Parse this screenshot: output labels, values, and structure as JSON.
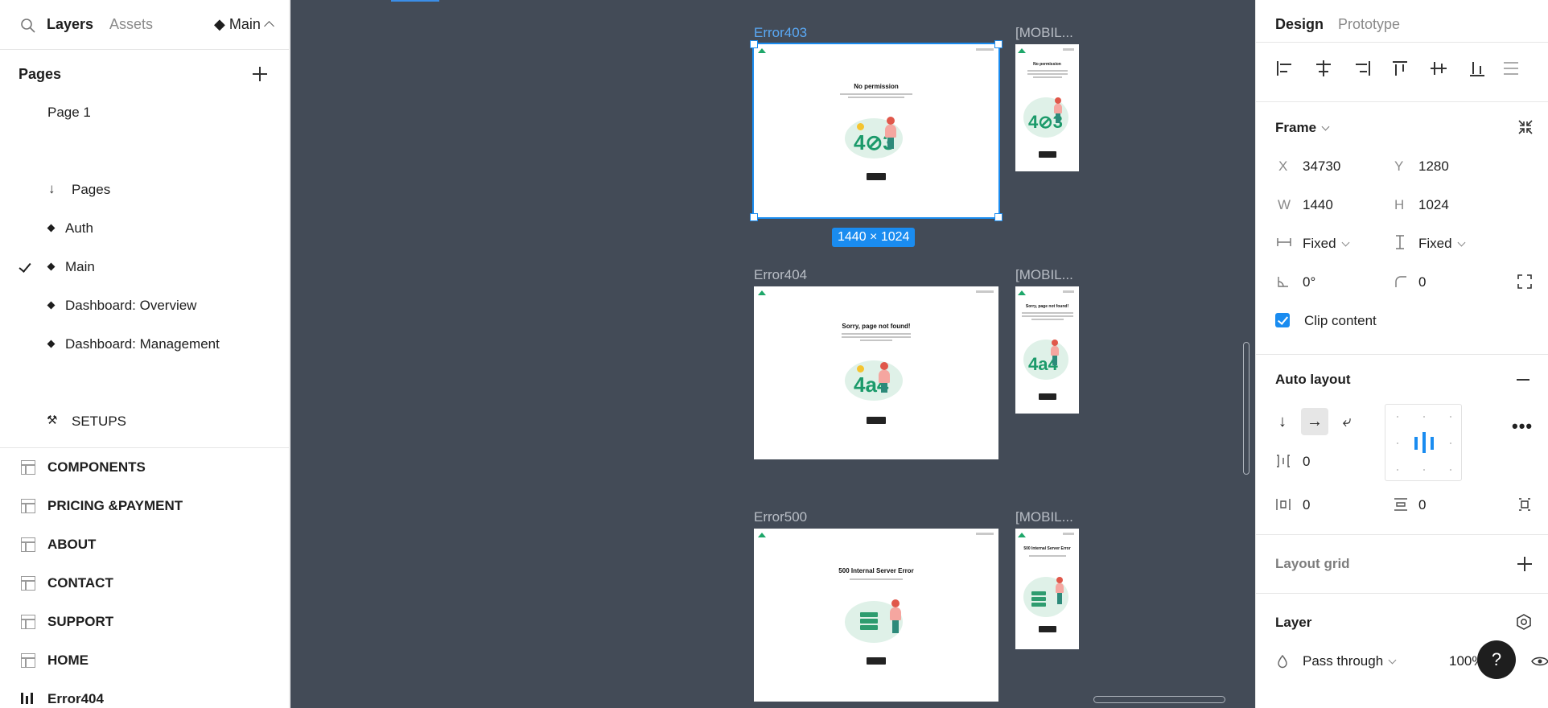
{
  "left_panel": {
    "tabs": {
      "layers": "Layers",
      "assets": "Assets"
    },
    "page_switcher": "◆ Main",
    "pages_heading": "Pages",
    "pages": [
      {
        "label": "Page 1",
        "marker": "none"
      },
      {
        "label": "Pages",
        "marker": "arrow"
      },
      {
        "label": "Auth",
        "marker": "diamond"
      },
      {
        "label": "Main",
        "marker": "diamond",
        "current": true
      },
      {
        "label": "Dashboard: Overview",
        "marker": "diamond"
      },
      {
        "label": "Dashboard: Management",
        "marker": "diamond"
      },
      {
        "label": "SETUPS",
        "marker": "tools"
      }
    ],
    "layers": [
      {
        "label": "COMPONENTS",
        "icon": "frame-icon"
      },
      {
        "label": "PRICING &PAYMENT",
        "icon": "frame-icon"
      },
      {
        "label": "ABOUT",
        "icon": "frame-icon"
      },
      {
        "label": "CONTACT",
        "icon": "frame-icon"
      },
      {
        "label": "SUPPORT",
        "icon": "frame-icon"
      },
      {
        "label": "HOME",
        "icon": "frame-icon"
      },
      {
        "label": "Error404",
        "icon": "auto-layout-icon"
      }
    ]
  },
  "canvas": {
    "background": "#434b57",
    "frames": [
      {
        "name": "Error403",
        "mobile_name": "[MOBIL...",
        "title": "No permission",
        "digits": "4⊘3",
        "selected": true
      },
      {
        "name": "Error404",
        "mobile_name": "[MOBIL...",
        "title": "Sorry, page not found!",
        "digits": "4a4",
        "selected": false
      },
      {
        "name": "Error500",
        "mobile_name": "[MOBIL...",
        "title": "500 Internal Server Error",
        "digits": "",
        "selected": false
      }
    ],
    "selection_size": "1440 × 1024"
  },
  "right_panel": {
    "tabs": {
      "design": "Design",
      "prototype": "Prototype"
    },
    "frame": {
      "title": "Frame",
      "x_label": "X",
      "x": "34730",
      "y_label": "Y",
      "y": "1280",
      "w_label": "W",
      "w": "1440",
      "h_label": "H",
      "h": "1024",
      "width_mode": "Fixed",
      "height_mode": "Fixed",
      "rotation": "0°",
      "radius": "0",
      "clip_content": "Clip content"
    },
    "auto_layout": {
      "title": "Auto layout",
      "gap": "0",
      "padding_h": "0",
      "padding_v": "0"
    },
    "layout_grid": {
      "title": "Layout grid"
    },
    "layer": {
      "title": "Layer",
      "blend": "Pass through",
      "opacity": "100%"
    },
    "accent": "#1a8cf0"
  },
  "help_label": "?"
}
